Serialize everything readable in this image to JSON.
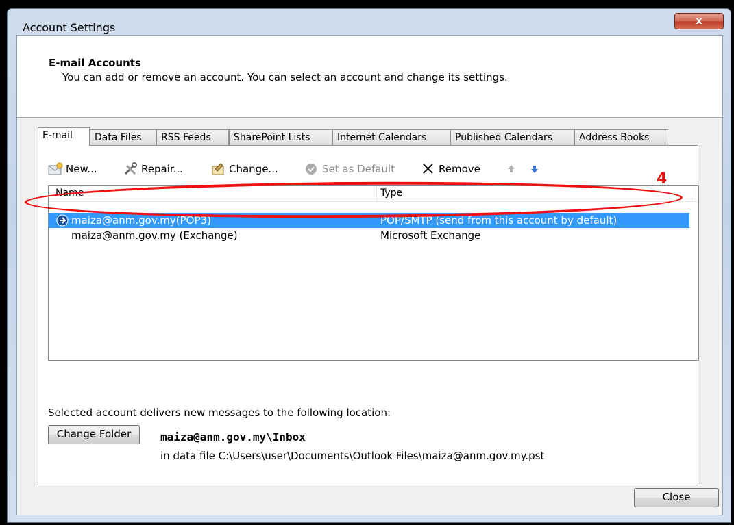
{
  "window": {
    "title": "Account Settings",
    "close_glyph": "x"
  },
  "header": {
    "title": "E-mail Accounts",
    "description": "You can add or remove an account. You can select an account and change its settings."
  },
  "tabs": [
    {
      "label": "E-mail",
      "active": true
    },
    {
      "label": "Data Files"
    },
    {
      "label": "RSS Feeds"
    },
    {
      "label": "SharePoint Lists"
    },
    {
      "label": "Internet Calendars"
    },
    {
      "label": "Published Calendars"
    },
    {
      "label": "Address Books"
    }
  ],
  "toolbar": {
    "new_label": "New...",
    "repair_label": "Repair...",
    "change_label": "Change...",
    "set_default_label": "Set as Default",
    "remove_label": "Remove"
  },
  "list": {
    "columns": {
      "name": "Name",
      "type": "Type"
    },
    "rows": [
      {
        "name": "maiza@anm.gov.my(POP3)",
        "type": "POP/SMTP (send from this account by default)",
        "selected": true
      },
      {
        "name": "maiza@anm.gov.my (Exchange)",
        "type": "Microsoft Exchange",
        "selected": false
      }
    ]
  },
  "delivery": {
    "text": "Selected account delivers new messages to the following location:",
    "change_folder_label": "Change Folder",
    "location": "maiza@anm.gov.my\\Inbox",
    "data_file": "in data file C:\\Users\\user\\Documents\\Outlook Files\\maiza@anm.gov.my.pst"
  },
  "footer": {
    "close_label": "Close"
  },
  "annotation": {
    "number": "4",
    "color": "#e11111"
  },
  "colors": {
    "selection": "#3399ff",
    "accent_blue": "#3a6fd8"
  }
}
